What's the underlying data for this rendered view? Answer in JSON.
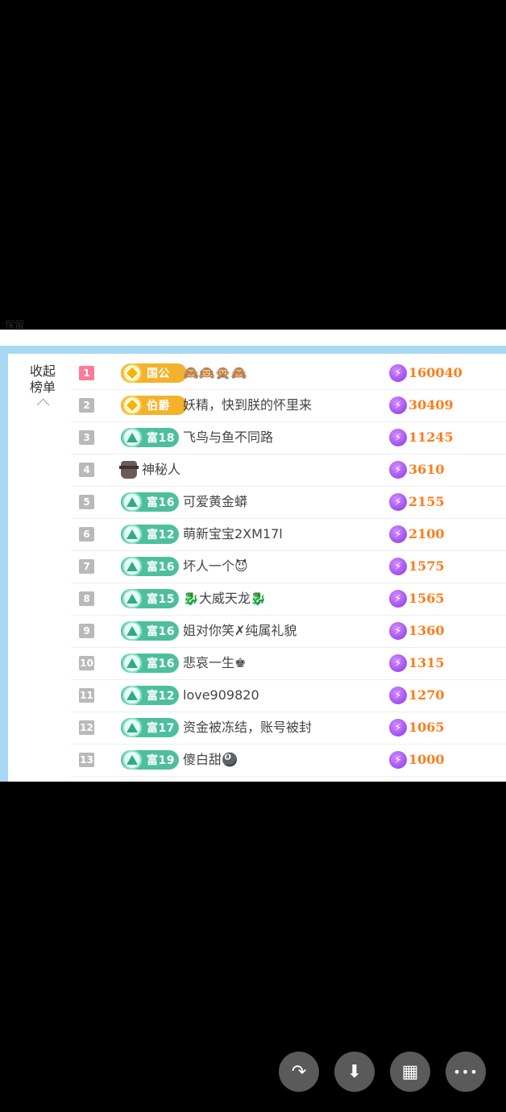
{
  "peek_text": "保留",
  "collapse": {
    "line1": "收起",
    "line2": "榜单"
  },
  "rows": [
    {
      "rank": "1",
      "badge": "国公",
      "badge_type": "gold",
      "name": "🙈🙉🙊🙈",
      "score": "160040"
    },
    {
      "rank": "2",
      "badge": "伯爵",
      "badge_type": "gold",
      "name": "妖精，快到朕的怀里来",
      "score": "30409"
    },
    {
      "rank": "3",
      "badge": "富18",
      "badge_type": "teal",
      "name": "飞鸟与鱼不同路",
      "score": "11245"
    },
    {
      "rank": "4",
      "badge": "",
      "badge_type": "mystery",
      "name": "神秘人",
      "score": "3610"
    },
    {
      "rank": "5",
      "badge": "富16",
      "badge_type": "teal",
      "name": "可爱黄金蟒",
      "score": "2155"
    },
    {
      "rank": "6",
      "badge": "富12",
      "badge_type": "teal",
      "name": "萌新宝宝2XM17l",
      "score": "2100"
    },
    {
      "rank": "7",
      "badge": "富16",
      "badge_type": "teal",
      "name": "坏人一个😈",
      "score": "1575"
    },
    {
      "rank": "8",
      "badge": "富15",
      "badge_type": "teal",
      "name": "🐉大威天龙🐉",
      "score": "1565"
    },
    {
      "rank": "9",
      "badge": "富16",
      "badge_type": "teal",
      "name": "姐对你笑✗纯属礼貌",
      "score": "1360"
    },
    {
      "rank": "10",
      "badge": "富16",
      "badge_type": "teal",
      "name": "悲哀一生♚",
      "score": "1315"
    },
    {
      "rank": "11",
      "badge": "富12",
      "badge_type": "teal",
      "name": "love909820",
      "score": "1270"
    },
    {
      "rank": "12",
      "badge": "富17",
      "badge_type": "teal",
      "name": "资金被冻结，账号被封",
      "score": "1065"
    },
    {
      "rank": "13",
      "badge": "富19",
      "badge_type": "teal",
      "name": "傻白甜🎱",
      "score": "1000"
    }
  ],
  "toolbar": {
    "share_icon": "↷",
    "download_icon": "⬇",
    "grid_icon": "▦",
    "more_icon": "•••"
  }
}
